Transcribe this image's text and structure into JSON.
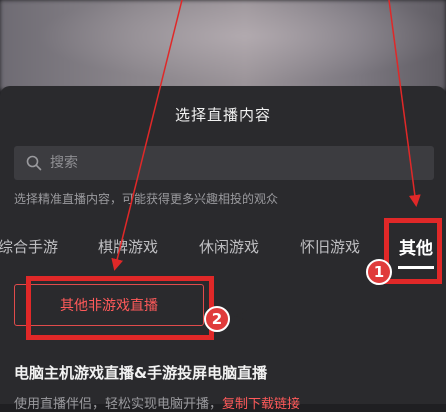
{
  "sheet": {
    "title": "选择直播内容"
  },
  "search": {
    "placeholder": "搜索",
    "icon": "search-icon"
  },
  "hint": "选择精准直播内容，可能获得更多兴趣相投的观众",
  "tabs": [
    {
      "label": "综合手游"
    },
    {
      "label": "棋牌游戏"
    },
    {
      "label": "休闲游戏"
    },
    {
      "label": "怀旧游戏"
    },
    {
      "label": "其他"
    }
  ],
  "active_tab": "其他",
  "chip": {
    "label": "其他非游戏直播"
  },
  "section": {
    "title": "电脑主机游戏直播&手游投屏电脑直播",
    "desc_text": "使用直播伴侣，轻松实现电脑开播，",
    "desc_link": "复制下载链接"
  },
  "annotations": {
    "marker_1": "1",
    "marker_2": "2",
    "color": "#e02828"
  }
}
